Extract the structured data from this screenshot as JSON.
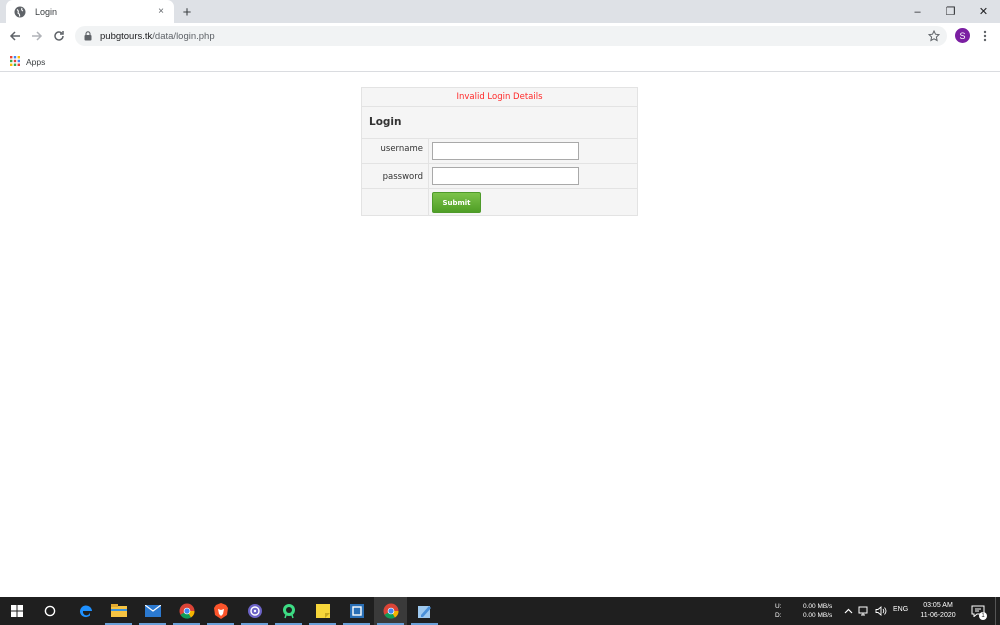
{
  "browser": {
    "tab_title": "Login",
    "tab_close": "×",
    "new_tab": "+",
    "url_host": "pubgtours.tk",
    "url_path": "/data/login.php",
    "avatar_letter": "S",
    "bookmarks_apps_label": "Apps",
    "window_controls": [
      "–",
      "❐",
      "✕"
    ]
  },
  "login": {
    "error_message": "Invalid Login Details",
    "heading": "Login",
    "username_label": "username",
    "username_value": "",
    "password_label": "password",
    "password_value": "",
    "submit_label": "Submit"
  },
  "taskbar": {
    "net_labels": [
      "U:",
      "D:"
    ],
    "net_values": [
      "0.00 MB/s",
      "0.00 MB/s"
    ],
    "language": "ENG",
    "time": "03:05 AM",
    "date": "11-06-2020",
    "notification_count": "1",
    "apps": [
      "start-icon",
      "search-circle-icon",
      "edge-icon",
      "file-explorer-icon",
      "mail-icon",
      "chrome-icon",
      "brave-icon",
      "torrent-icon",
      "android-studio-icon",
      "sticky-notes-icon",
      "virtualbox-icon",
      "chrome-icon",
      "notepad-icon"
    ]
  },
  "colors": {
    "error": "#ff2a2a",
    "submit_green": "#5aa82f",
    "avatar_purple": "#7b1fa2",
    "taskbar_bg": "#1f1f1f"
  }
}
